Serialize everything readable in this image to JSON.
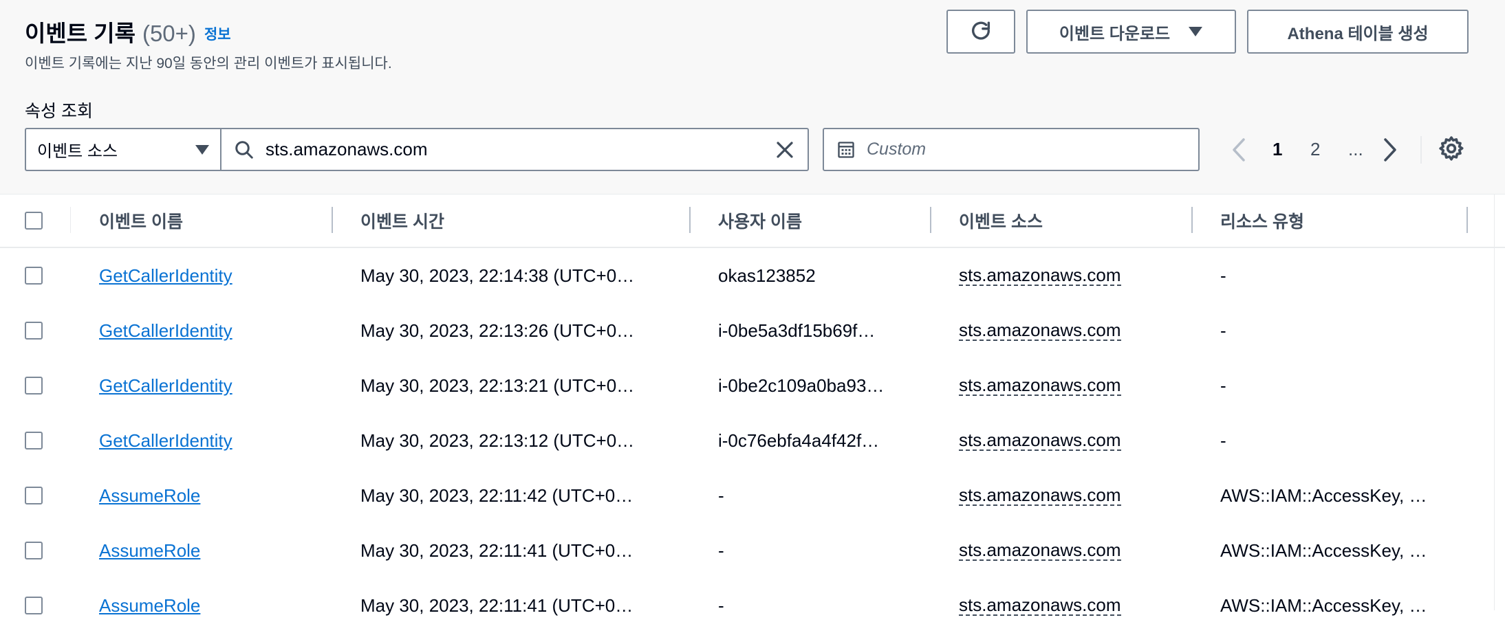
{
  "header": {
    "title": "이벤트 기록",
    "count": "(50+)",
    "info_link": "정보",
    "description": "이벤트 기록에는 지난 90일 동안의 관리 이벤트가 표시됩니다."
  },
  "actions": {
    "refresh_icon": "refresh-icon",
    "download_label": "이벤트 다운로드",
    "athena_label": "Athena 테이블 생성"
  },
  "filter": {
    "label": "속성 조회",
    "attribute": "이벤트 소스",
    "search_value": "sts.amazonaws.com",
    "date_placeholder": "Custom"
  },
  "pagination": {
    "pages": [
      "1",
      "2",
      "..."
    ],
    "current": "1"
  },
  "table": {
    "columns": [
      "이벤트 이름",
      "이벤트 시간",
      "사용자 이름",
      "이벤트 소스",
      "리소스 유형"
    ],
    "rows": [
      {
        "name": "GetCallerIdentity",
        "time": "May 30, 2023, 22:14:38 (UTC+0…",
        "user": "okas123852",
        "source": "sts.amazonaws.com",
        "resource": "-"
      },
      {
        "name": "GetCallerIdentity",
        "time": "May 30, 2023, 22:13:26 (UTC+0…",
        "user": "i-0be5a3df15b69f…",
        "source": "sts.amazonaws.com",
        "resource": "-"
      },
      {
        "name": "GetCallerIdentity",
        "time": "May 30, 2023, 22:13:21 (UTC+0…",
        "user": "i-0be2c109a0ba93…",
        "source": "sts.amazonaws.com",
        "resource": "-"
      },
      {
        "name": "GetCallerIdentity",
        "time": "May 30, 2023, 22:13:12 (UTC+0…",
        "user": "i-0c76ebfa4a4f42f…",
        "source": "sts.amazonaws.com",
        "resource": "-"
      },
      {
        "name": "AssumeRole",
        "time": "May 30, 2023, 22:11:42 (UTC+0…",
        "user": "-",
        "source": "sts.amazonaws.com",
        "resource": "AWS::IAM::AccessKey, …"
      },
      {
        "name": "AssumeRole",
        "time": "May 30, 2023, 22:11:41 (UTC+0…",
        "user": "-",
        "source": "sts.amazonaws.com",
        "resource": "AWS::IAM::AccessKey, …"
      },
      {
        "name": "AssumeRole",
        "time": "May 30, 2023, 22:11:41 (UTC+0…",
        "user": "-",
        "source": "sts.amazonaws.com",
        "resource": "AWS::IAM::AccessKey, …"
      }
    ]
  },
  "colors": {
    "link": "#0972d3",
    "text": "#000716",
    "muted": "#414d5c",
    "border": "#7d8998",
    "header_bg": "#f8f8f8"
  }
}
